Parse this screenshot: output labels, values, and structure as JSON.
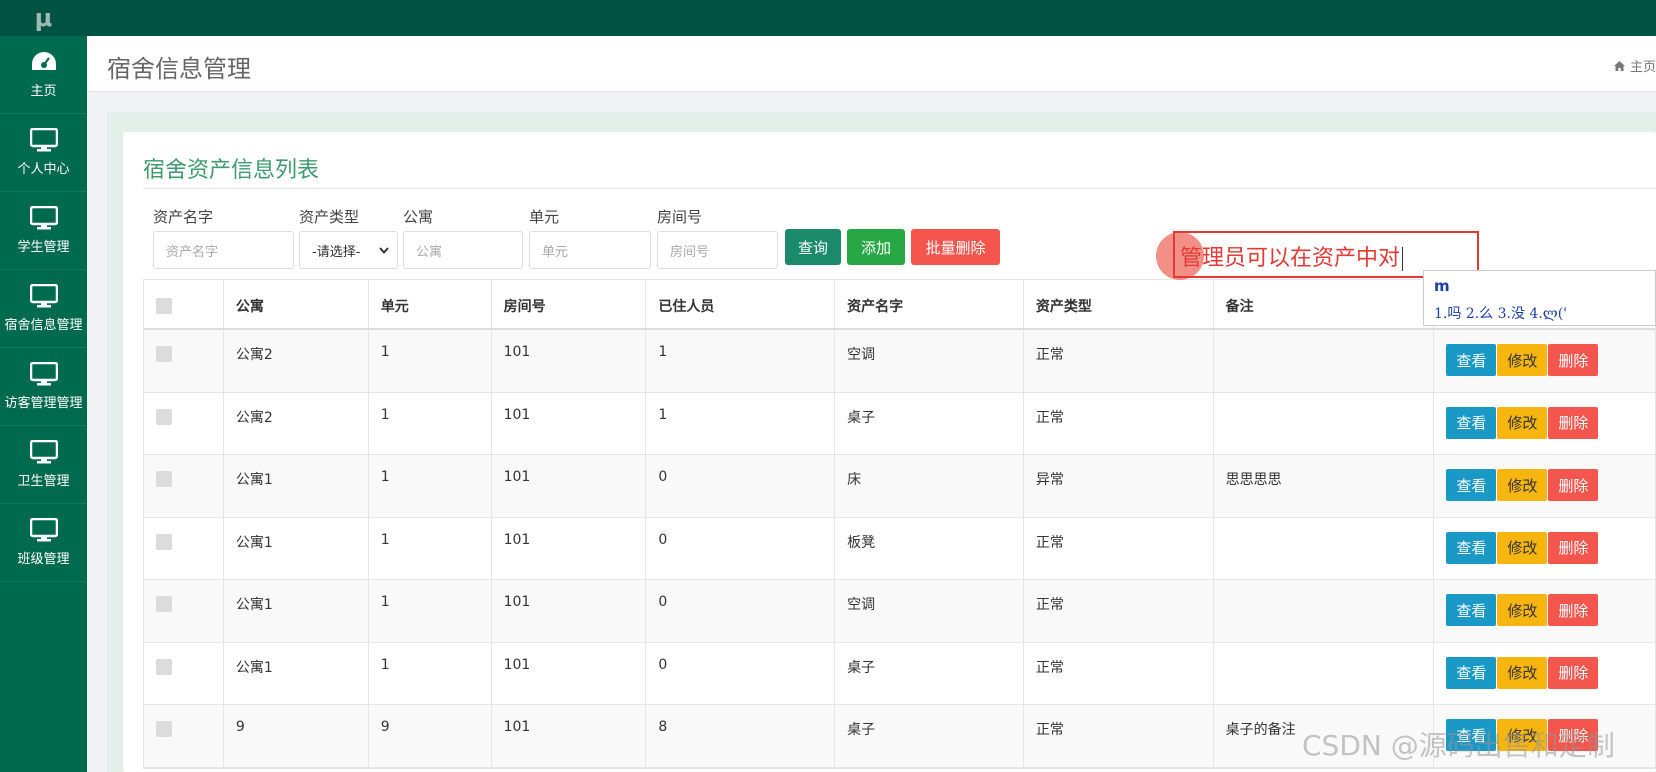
{
  "app": {
    "logo": "μ",
    "page_title": "宿舍信息管理",
    "breadcrumb_home": "主页"
  },
  "sidebar": {
    "items": [
      {
        "label": "主页",
        "icon": "dashboard-icon"
      },
      {
        "label": "个人中心",
        "icon": "monitor-icon"
      },
      {
        "label": "学生管理",
        "icon": "monitor-icon"
      },
      {
        "label": "宿舍信息管理",
        "icon": "monitor-icon"
      },
      {
        "label": "访客管理管理",
        "icon": "monitor-icon"
      },
      {
        "label": "卫生管理",
        "icon": "monitor-icon"
      },
      {
        "label": "班级管理",
        "icon": "monitor-icon"
      }
    ]
  },
  "card": {
    "title": "宿舍资产信息列表"
  },
  "filters": {
    "asset_name": {
      "label": "资产名字",
      "placeholder": "资产名字"
    },
    "asset_type": {
      "label": "资产类型",
      "value": "-请选择-"
    },
    "apartment": {
      "label": "公寓",
      "placeholder": "公寓"
    },
    "unit": {
      "label": "单元",
      "placeholder": "单元"
    },
    "room": {
      "label": "房间号",
      "placeholder": "房间号"
    }
  },
  "buttons": {
    "search": "查询",
    "add": "添加",
    "batch_delete": "批量删除"
  },
  "table": {
    "headers": [
      "公寓",
      "单元",
      "房间号",
      "已住人员",
      "资产名字",
      "资产类型",
      "备注"
    ],
    "rows": [
      [
        "公寓2",
        "1",
        "101",
        "1",
        "空调",
        "正常",
        ""
      ],
      [
        "公寓2",
        "1",
        "101",
        "1",
        "桌子",
        "正常",
        ""
      ],
      [
        "公寓1",
        "1",
        "101",
        "0",
        "床",
        "异常",
        "思思思思"
      ],
      [
        "公寓1",
        "1",
        "101",
        "0",
        "板凳",
        "正常",
        ""
      ],
      [
        "公寓1",
        "1",
        "101",
        "0",
        "空调",
        "正常",
        ""
      ],
      [
        "公寓1",
        "1",
        "101",
        "0",
        "桌子",
        "正常",
        ""
      ],
      [
        "9",
        "9",
        "101",
        "8",
        "桌子",
        "正常",
        "桌子的备注"
      ]
    ],
    "actions": {
      "view": "查看",
      "edit": "修改",
      "delete": "删除"
    }
  },
  "ime": {
    "composed_text": "管理员可以在资产中对",
    "pinyin": "m",
    "candidates": "1.吗  2.么  3.没  4.ლ('"
  },
  "watermark": "CSDN @源码出售和定制",
  "colors": {
    "topbar": "#005242",
    "sidebar": "#006a4f",
    "accent": "#3e9b6f",
    "search": "#1b8a6b",
    "add": "#28a745",
    "danger": "#f4564e",
    "info": "#1a98c6",
    "warning": "#f7b50f"
  }
}
